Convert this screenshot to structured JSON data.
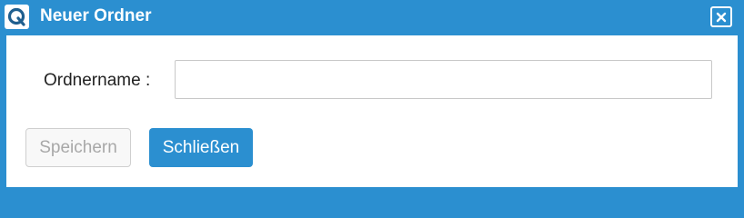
{
  "window": {
    "title": "Neuer Ordner",
    "logo_icon": "app-logo-q-icon",
    "close_icon": "close-x-icon"
  },
  "form": {
    "name_label": "Ordnername :",
    "name_value": "",
    "name_placeholder": ""
  },
  "actions": {
    "save_label": "Speichern",
    "save_disabled": true,
    "close_label": "Schließen"
  },
  "colors": {
    "accent": "#2b8fd0",
    "background": "#ffffff",
    "disabled_text": "#a8a8a8"
  }
}
